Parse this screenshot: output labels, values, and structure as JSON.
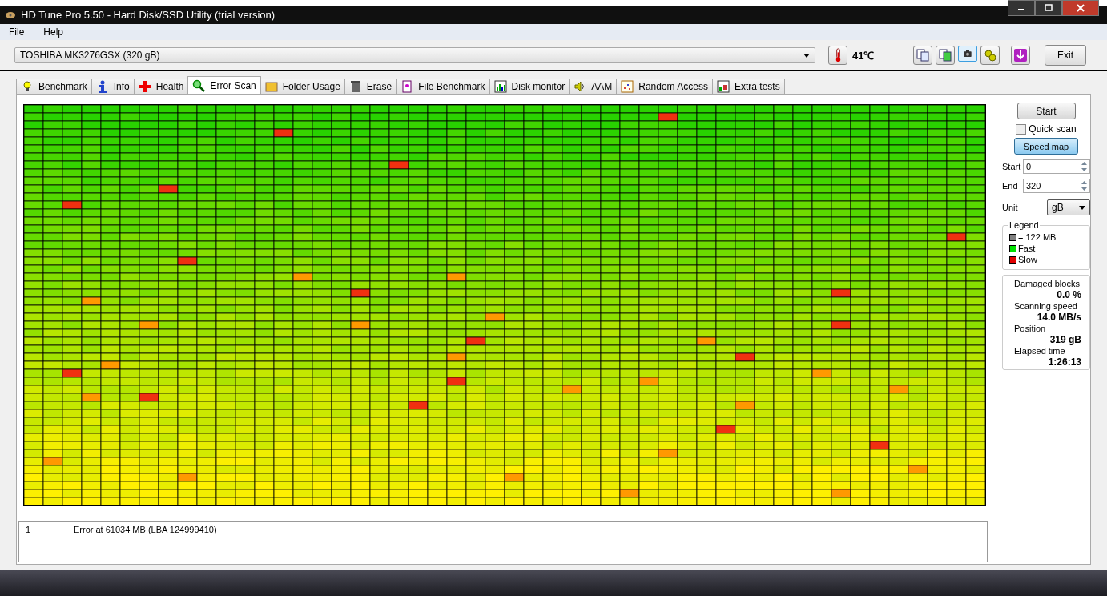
{
  "window": {
    "title": "HD Tune Pro 5.50 - Hard Disk/SSD Utility (trial version)"
  },
  "menu": [
    "File",
    "Help"
  ],
  "drive": {
    "value": "TOSHIBA MK3276GSX (320 gB)"
  },
  "temperature": "41℃",
  "toolbar_buttons": [
    {
      "kind": "copy",
      "selected": false
    },
    {
      "kind": "copy-image",
      "selected": false
    },
    {
      "kind": "camera",
      "selected": true
    },
    {
      "kind": "options",
      "selected": false
    },
    {
      "kind": "download",
      "selected": false
    }
  ],
  "exit_button": "Exit",
  "tabs": [
    {
      "label": "Benchmark",
      "kind": "bulb",
      "selected": false
    },
    {
      "label": "Info",
      "kind": "info",
      "selected": false
    },
    {
      "label": "Health",
      "kind": "cross",
      "selected": false
    },
    {
      "label": "Error Scan",
      "kind": "magnifier",
      "selected": true
    },
    {
      "label": "Folder Usage",
      "kind": "folder",
      "selected": false
    },
    {
      "label": "Erase",
      "kind": "trash",
      "selected": false
    },
    {
      "label": "File Benchmark",
      "kind": "file",
      "selected": false
    },
    {
      "label": "Disk monitor",
      "kind": "bars",
      "selected": false
    },
    {
      "label": "AAM",
      "kind": "speaker",
      "selected": false
    },
    {
      "label": "Random Access",
      "kind": "dots",
      "selected": false
    },
    {
      "label": "Extra tests",
      "kind": "grid",
      "selected": false
    }
  ],
  "controls": {
    "start_button": "Start",
    "quick_scan": {
      "label": "Quick scan",
      "checked": false
    },
    "speed_map": {
      "label": "Speed map",
      "on": true
    },
    "start": {
      "label": "Start",
      "value": "0"
    },
    "end": {
      "label": "End",
      "value": "320"
    },
    "unit": {
      "label": "Unit",
      "value": "gB"
    }
  },
  "legend": {
    "title": "Legend",
    "items": [
      {
        "label": "= 122 MB",
        "color": "#808080"
      },
      {
        "label": "Fast",
        "color": "#00e000"
      },
      {
        "label": "Slow",
        "color": "#e00000"
      }
    ]
  },
  "stats": [
    {
      "label": "Damaged blocks",
      "value": "0.0 %"
    },
    {
      "label": "Scanning speed",
      "value": "14.0 MB/s"
    },
    {
      "label": "Position",
      "value": "319 gB"
    },
    {
      "label": "Elapsed time",
      "value": "1:26:13"
    }
  ],
  "log": [
    {
      "number": "1",
      "message": "Error at 61034 MB (LBA 124999410)"
    }
  ]
}
